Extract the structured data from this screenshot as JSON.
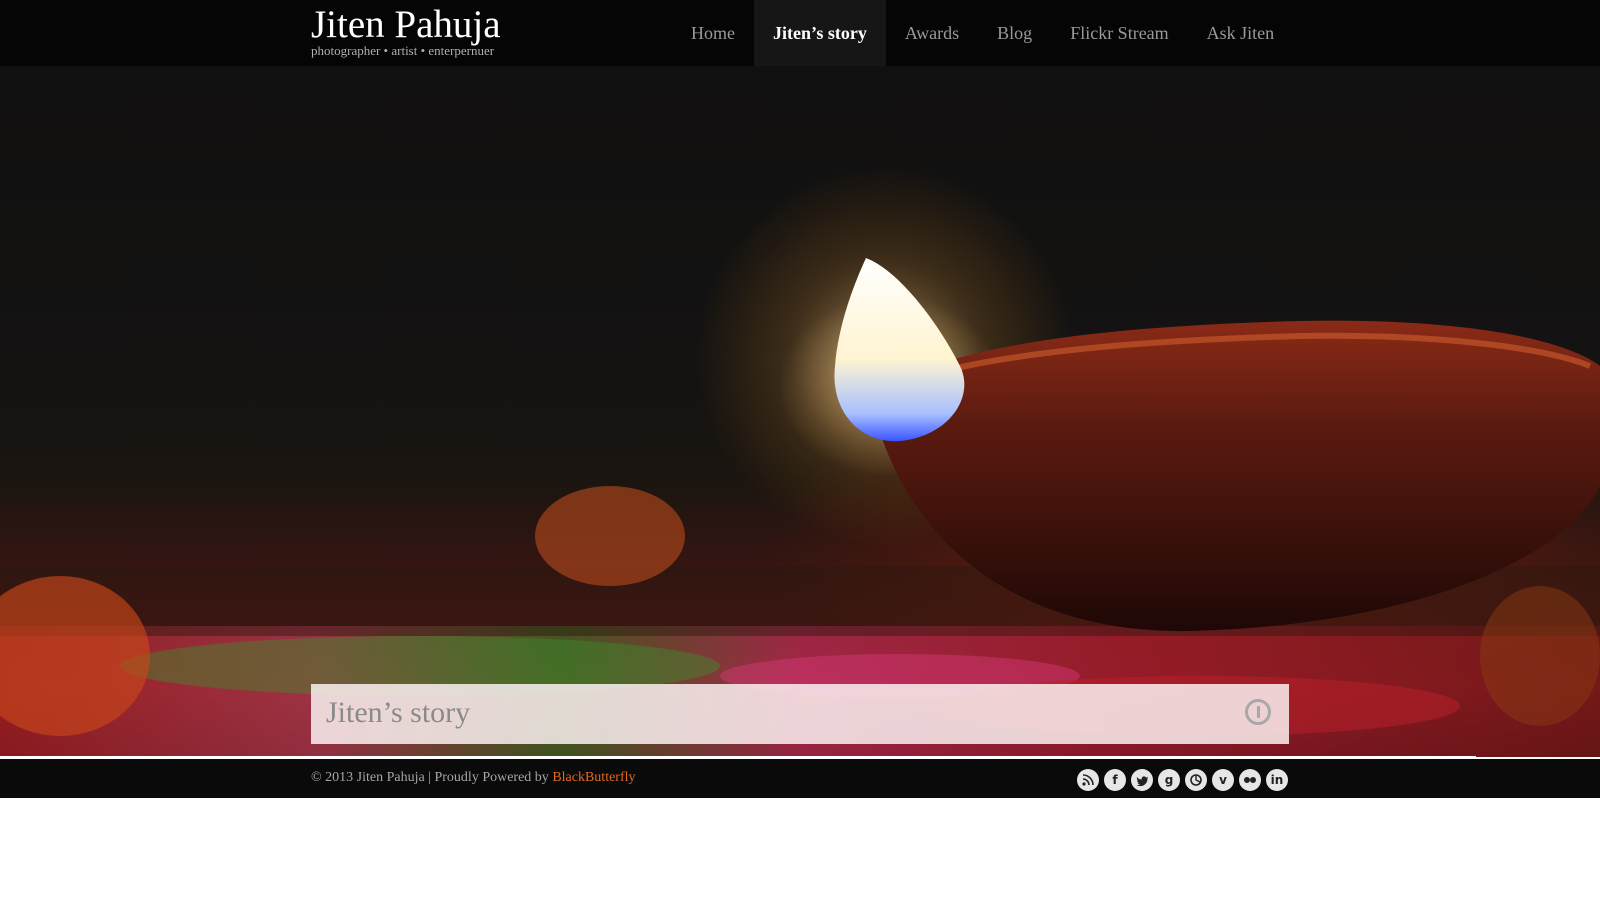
{
  "header": {
    "title": "Jiten Pahuja",
    "tagline": "photographer • artist • enterpernuer"
  },
  "nav": {
    "items": [
      {
        "label": "Home"
      },
      {
        "label": "Jiten’s story"
      },
      {
        "label": "Awards"
      },
      {
        "label": "Blog"
      },
      {
        "label": "Flickr Stream"
      },
      {
        "label": "Ask Jiten"
      }
    ],
    "active_index": 1
  },
  "hero": {
    "caption": "Jiten’s story",
    "control_icon": "pause-icon"
  },
  "footer": {
    "copyright": "© 2013 Jiten Pahuja | Proudly Powered by",
    "link_label": "BlackButterfly",
    "link_color": "#e06a22",
    "social": [
      {
        "icon": "rss-icon"
      },
      {
        "icon": "facebook-icon"
      },
      {
        "icon": "twitter-icon"
      },
      {
        "icon": "google-plus-icon"
      },
      {
        "icon": "picasa-icon"
      },
      {
        "icon": "vimeo-icon"
      },
      {
        "icon": "flickr-icon"
      },
      {
        "icon": "linkedin-icon"
      }
    ]
  }
}
